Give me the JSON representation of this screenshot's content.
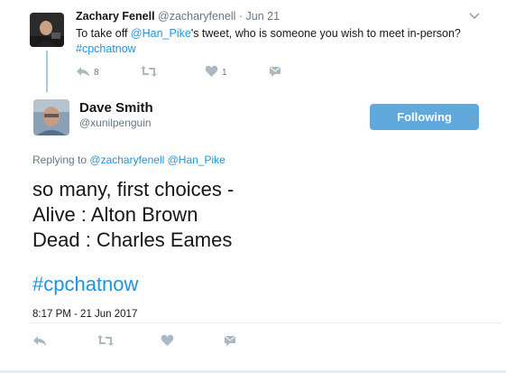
{
  "parent_tweet": {
    "author_name": "Zachary Fenell",
    "author_handle": "@zacharyfenell",
    "separator": "·",
    "date": "Jun 21",
    "text_prefix": "To take off ",
    "mention": "@Han_Pike",
    "text_suffix": "'s tweet, who is someone you wish to meet in-person?",
    "hashtag": "#cpchatnow",
    "reply_count": "8",
    "like_count": "1"
  },
  "main_tweet": {
    "author_name": "Dave Smith",
    "author_handle": "@xunilpenguin",
    "follow_label": "Following",
    "replying_to_prefix": "Replying to",
    "replying_to": [
      "@zacharyfenell",
      "@Han_Pike"
    ],
    "text_lines": [
      "so many, first choices -",
      "Alive : Alton Brown",
      "Dead : Charles Eames"
    ],
    "hashtag": "#cpchatnow",
    "timestamp": "8:17 PM - 21 Jun 2017"
  },
  "icons": [
    "reply-icon",
    "retweet-icon",
    "like-icon",
    "direct-message-icon",
    "chevron-down-icon"
  ],
  "colors": {
    "link": "#1b95e0",
    "follow_button": "#5fa9dd",
    "muted": "#657786",
    "thread_line": "#a7cbe6"
  }
}
